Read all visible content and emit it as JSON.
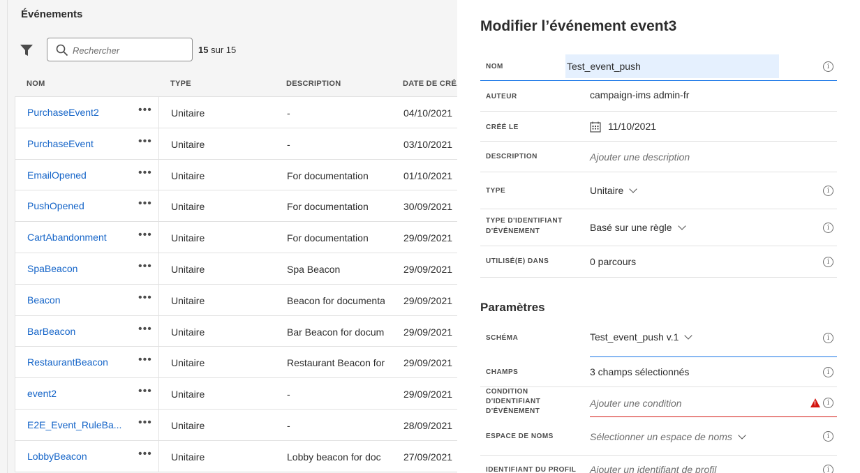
{
  "events_panel": {
    "title": "Événements",
    "search": {
      "placeholder": "Rechercher"
    },
    "count_shown": "15",
    "count_total": "sur 15",
    "columns": [
      "NOM",
      "TYPE",
      "DESCRIPTION",
      "DATE DE CRÉAT"
    ],
    "rows": [
      {
        "name": "PurchaseEvent2",
        "type": "Unitaire",
        "description": "-",
        "date": "04/10/2021"
      },
      {
        "name": "PurchaseEvent",
        "type": "Unitaire",
        "description": "-",
        "date": "03/10/2021"
      },
      {
        "name": "EmailOpened",
        "type": "Unitaire",
        "description": "For documentation",
        "date": "01/10/2021"
      },
      {
        "name": "PushOpened",
        "type": "Unitaire",
        "description": "For documentation",
        "date": "30/09/2021"
      },
      {
        "name": "CartAbandonment",
        "type": "Unitaire",
        "description": "For documentation",
        "date": "29/09/2021"
      },
      {
        "name": "SpaBeacon",
        "type": "Unitaire",
        "description": "Spa Beacon",
        "date": "29/09/2021"
      },
      {
        "name": "Beacon",
        "type": "Unitaire",
        "description": "Beacon for documenta",
        "date": "29/09/2021"
      },
      {
        "name": "BarBeacon",
        "type": "Unitaire",
        "description": "Bar Beacon for docum",
        "date": "29/09/2021"
      },
      {
        "name": "RestaurantBeacon",
        "type": "Unitaire",
        "description": "Restaurant Beacon for",
        "date": "29/09/2021"
      },
      {
        "name": "event2",
        "type": "Unitaire",
        "description": "-",
        "date": "29/09/2021"
      },
      {
        "name": "E2E_Event_RuleBa...",
        "type": "Unitaire",
        "description": "-",
        "date": "28/09/2021"
      },
      {
        "name": "LobbyBeacon",
        "type": "Unitaire",
        "description": "Lobby beacon for doc",
        "date": "27/09/2021"
      }
    ],
    "more_glyph": "•••"
  },
  "edit_panel": {
    "title": "Modifier l’événement event3",
    "nom_label": "NOM",
    "nom_value": "Test_event_push",
    "auteur_label": "AUTEUR",
    "auteur_value": "campaign-ims admin-fr",
    "cree_label": "CRÉÉ LE",
    "cree_value": "11/10/2021",
    "description_label": "DESCRIPTION",
    "description_placeholder": "Ajouter une description",
    "type_label": "TYPE",
    "type_value": "Unitaire",
    "id_type_label_1": "TYPE D'IDENTIFIANT",
    "id_type_label_2": "D'ÉVÉNEMENT",
    "id_type_value": "Basé sur une règle",
    "utilise_label": "UTILISÉ(E) DANS",
    "utilise_value": "0 parcours",
    "params_title": "Paramètres",
    "schema_label": "SCHÉMA",
    "schema_value": "Test_event_push v.1",
    "champs_label": "CHAMPS",
    "champs_value": "3 champs sélectionnés",
    "condition_label_1": "CONDITION",
    "condition_label_2": "D'IDENTIFIANT",
    "condition_label_3": "D'ÉVÉNEMENT",
    "condition_placeholder": "Ajouter une condition",
    "namespace_label": "ESPACE DE NOMS",
    "namespace_placeholder": "Sélectionner un espace de noms",
    "profile_label": "IDENTIFIANT DU PROFIL",
    "profile_placeholder": "Ajouter un identifiant de profil",
    "info_glyph": "i",
    "warn_glyph": "!"
  },
  "colors": {
    "link": "#1464c8",
    "error": "#d31510",
    "focus": "#1473e6",
    "input_highlight": "#e5f0fe"
  }
}
